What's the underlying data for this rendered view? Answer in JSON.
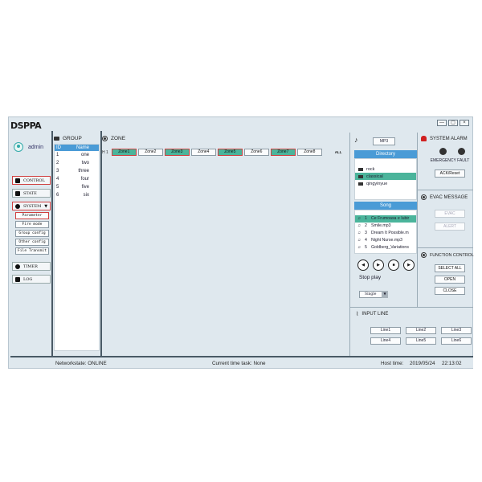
{
  "app": {
    "logo_text": "DSPPA",
    "window_controls": [
      "—",
      "▢",
      "×"
    ]
  },
  "sidebar": {
    "user_name": "admin",
    "nav": [
      {
        "label": "CONTROL",
        "icon": "monitor-icon",
        "active": true
      },
      {
        "label": "STATE",
        "icon": "state-icon",
        "active": false
      },
      {
        "label": "SYSTEM",
        "icon": "gear-icon",
        "active": false,
        "expanded": true
      }
    ],
    "system_sub": [
      {
        "label": "Parameter",
        "active": true
      },
      {
        "label": "Fire mode",
        "active": false
      },
      {
        "label": "Group config",
        "active": false
      },
      {
        "label": "Other config",
        "active": false
      },
      {
        "label": "File Transmit",
        "active": false
      }
    ],
    "nav_bottom": [
      {
        "label": "TIMER",
        "icon": "clock-icon"
      },
      {
        "label": "LOG",
        "icon": "log-icon"
      }
    ]
  },
  "group": {
    "title": "GROUP",
    "columns": [
      "ID",
      "Name"
    ],
    "rows": [
      {
        "id": "1",
        "name": "one"
      },
      {
        "id": "2",
        "name": "two"
      },
      {
        "id": "3",
        "name": "three"
      },
      {
        "id": "4",
        "name": "four"
      },
      {
        "id": "5",
        "name": "five"
      },
      {
        "id": "6",
        "name": "six"
      }
    ]
  },
  "zone": {
    "title": "ZONE",
    "row_label": "H 1",
    "zones": [
      {
        "label": "Zone1",
        "selected": true
      },
      {
        "label": "Zone2",
        "selected": false
      },
      {
        "label": "Zone3",
        "selected": true
      },
      {
        "label": "Zone4",
        "selected": false
      },
      {
        "label": "Zone5",
        "selected": true
      },
      {
        "label": "Zone6",
        "selected": false
      },
      {
        "label": "Zone7",
        "selected": true
      },
      {
        "label": "Zone8",
        "selected": false
      }
    ],
    "all_label": "ALL"
  },
  "media": {
    "source_button": "MP3",
    "directory_title": "Directory",
    "directories": [
      {
        "name": "rock",
        "selected": false
      },
      {
        "name": "classical",
        "selected": true
      },
      {
        "name": "qingyinyue",
        "selected": false
      }
    ],
    "song_title": "Song",
    "songs": [
      {
        "no": "1",
        "name": "Ce Frumoasa e Iubir",
        "selected": true
      },
      {
        "no": "2",
        "name": "Smile.mp3",
        "selected": false
      },
      {
        "no": "3",
        "name": "Dream It Possible.m",
        "selected": false
      },
      {
        "no": "4",
        "name": "Night Nurse.mp3",
        "selected": false
      },
      {
        "no": "5",
        "name": "Goldberg_Variations",
        "selected": false
      }
    ],
    "controls": [
      "prev",
      "play",
      "stop",
      "next"
    ],
    "play_state": "Stop play",
    "play_mode": "Single"
  },
  "system_alarm": {
    "title": "SYSTEM ALARM",
    "indicator_label": "EMERGENCY FAULT",
    "ack_button": "ACK/Reset"
  },
  "evac": {
    "title": "EVAC MESSAGE",
    "buttons": [
      "EVAC",
      "ALERT"
    ]
  },
  "function_control": {
    "title": "FUNCTION CONTROL",
    "buttons": [
      "SELECT ALL",
      "OPEN",
      "CLOSE"
    ]
  },
  "input_line": {
    "title": "INPUT LINE",
    "lines": [
      "Line1",
      "Line2",
      "Line3",
      "Line4",
      "Line5",
      "Line6"
    ]
  },
  "status": {
    "network": "Networkstate: ONLINE",
    "task": "Current time task: None",
    "host_label": "Host time:",
    "date": "2019/05/24",
    "time": "22:13:02"
  }
}
